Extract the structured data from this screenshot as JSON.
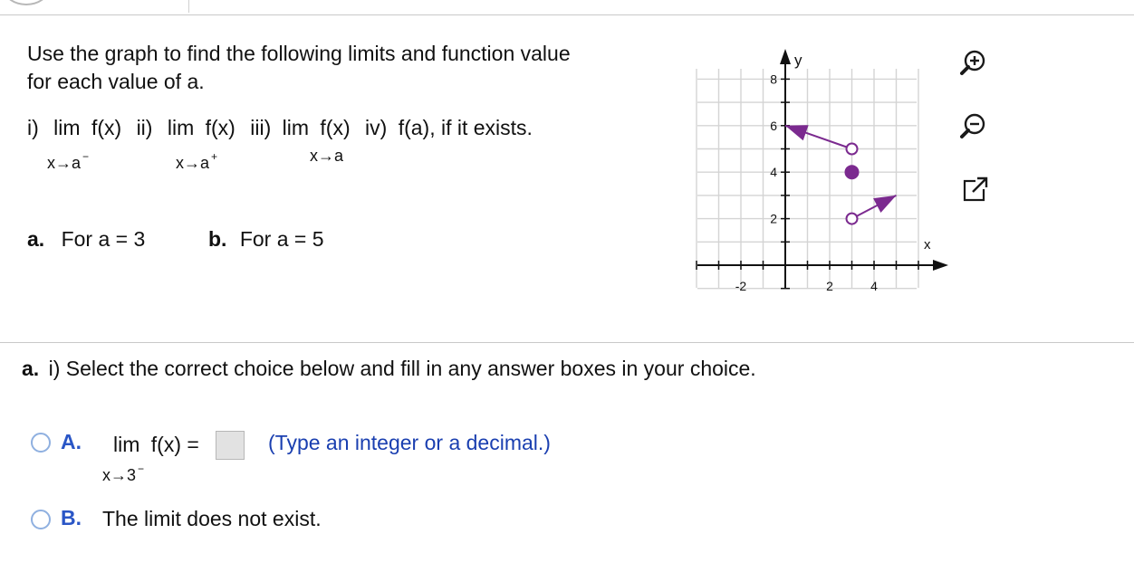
{
  "question": {
    "prompt_line1": "Use the graph to find the following limits and function value",
    "prompt_line2": "for each value of a.",
    "items": {
      "i_label": "i)",
      "i_lim": "lim",
      "i_fx": "f(x)",
      "i_sub": "x→a",
      "i_sup": "−",
      "ii_label": "ii)",
      "ii_lim": "lim",
      "ii_fx": "f(x)",
      "ii_sub": "x→a",
      "ii_sup": "+",
      "iii_label": "iii)",
      "iii_lim": "lim",
      "iii_fx": "f(x)",
      "iii_sub": "x→a",
      "iv_label": "iv)",
      "iv_text": "f(a), if it exists."
    },
    "part_a_letter": "a.",
    "part_a_text": "For a = 3",
    "part_b_letter": "b.",
    "part_b_text": "For a = 5"
  },
  "graph": {
    "x_axis_label": "x",
    "y_axis_label": "y",
    "x_ticks": [
      "-2",
      "2",
      "4"
    ],
    "y_ticks": [
      "2",
      "4",
      "6",
      "8"
    ],
    "line_color": "#7b2a8f",
    "segments": [
      {
        "from": [
          0,
          6
        ],
        "to": [
          3,
          5
        ],
        "start": "arrow",
        "end": "open"
      },
      {
        "from": [
          3,
          2
        ],
        "to": [
          5,
          3
        ],
        "start": "open",
        "end": "arrow"
      }
    ],
    "points": [
      {
        "x": 3,
        "y": 4,
        "style": "closed"
      }
    ]
  },
  "tools": {
    "zoom_in": "zoom-in-icon",
    "zoom_out": "zoom-out-icon",
    "popout": "external-link-icon"
  },
  "sub_question": {
    "label": "a.",
    "text": "i) Select the correct choice below and fill in any answer boxes in your choice."
  },
  "choices": {
    "a_letter": "A.",
    "a_lim": "lim",
    "a_fx": "f(x) =",
    "a_sub": "x→3",
    "a_sup": "−",
    "a_hint": "(Type an integer or a decimal.)",
    "b_letter": "B.",
    "b_text": "The limit does not exist."
  },
  "colors": {
    "accent_blue": "#2a56c6",
    "graph_purple": "#7b2a8f"
  }
}
